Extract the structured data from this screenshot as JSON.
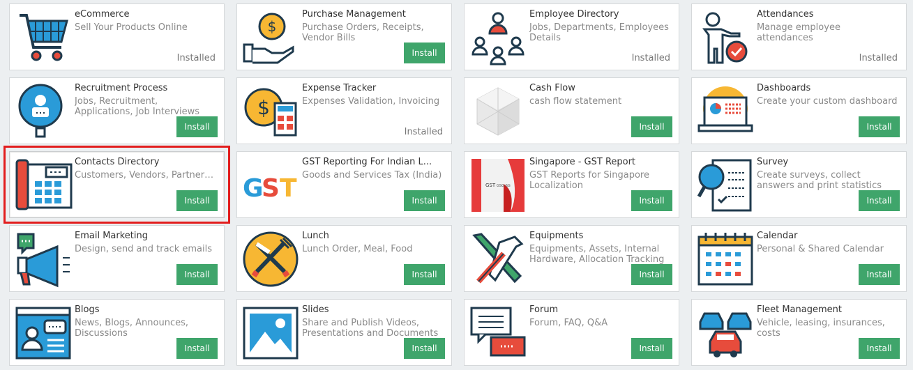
{
  "apps": [
    {
      "title": "eCommerce",
      "desc": "Sell Your Products Online",
      "status": "Installed",
      "icon": "shopping-cart-icon"
    },
    {
      "title": "Purchase Management",
      "desc": "Purchase Orders, Receipts, Vendor Bills",
      "status": "Install",
      "icon": "money-hand-icon"
    },
    {
      "title": "Employee Directory",
      "desc": "Jobs, Departments, Employees Details",
      "status": "Installed",
      "icon": "people-network-icon"
    },
    {
      "title": "Attendances",
      "desc": "Manage employee attendances",
      "status": "Installed",
      "icon": "attendance-icon"
    },
    {
      "title": "Recruitment Process",
      "desc": "Jobs, Recruitment, Applications, Job Interviews",
      "status": "Install",
      "icon": "recruitment-icon"
    },
    {
      "title": "Expense Tracker",
      "desc": "Expenses Validation, Invoicing",
      "status": "Installed",
      "icon": "expense-calculator-icon"
    },
    {
      "title": "Cash Flow",
      "desc": "cash flow statement",
      "status": "Install",
      "icon": "cube-icon"
    },
    {
      "title": "Dashboards",
      "desc": "Create your custom dashboard",
      "status": "Install",
      "icon": "dashboard-laptop-icon"
    },
    {
      "title": "Contacts Directory",
      "desc": "Customers, Vendors, Partners,...",
      "status": "Install",
      "icon": "phone-directory-icon"
    },
    {
      "title": "GST Reporting For Indian L...",
      "desc": "Goods and Services Tax (India)",
      "status": "Install",
      "icon": "gst-logo-icon"
    },
    {
      "title": "Singapore - GST Report",
      "desc": "GST Reports for Singapore Localization",
      "status": "Install",
      "icon": "singapore-flag-icon"
    },
    {
      "title": "Survey",
      "desc": "Create surveys, collect answers and print statistics",
      "status": "Install",
      "icon": "survey-magnifier-icon"
    },
    {
      "title": "Email Marketing",
      "desc": "Design, send and track emails",
      "status": "Install",
      "icon": "megaphone-icon"
    },
    {
      "title": "Lunch",
      "desc": "Lunch Order, Meal, Food",
      "status": "Install",
      "icon": "fork-knife-icon"
    },
    {
      "title": "Equipments",
      "desc": "Equipments, Assets, Internal Hardware, Allocation Tracking",
      "status": "Install",
      "icon": "tools-icon"
    },
    {
      "title": "Calendar",
      "desc": "Personal & Shared Calendar",
      "status": "Install",
      "icon": "calendar-icon"
    },
    {
      "title": "Blogs",
      "desc": "News, Blogs, Announces, Discussions",
      "status": "Install",
      "icon": "blog-icon"
    },
    {
      "title": "Slides",
      "desc": "Share and Publish Videos, Presentations and Documents",
      "status": "Install",
      "icon": "slides-icon"
    },
    {
      "title": "Forum",
      "desc": "Forum, FAQ, Q&A",
      "status": "Install",
      "icon": "forum-chat-icon"
    },
    {
      "title": "Fleet Management",
      "desc": "Vehicle, leasing, insurances, costs",
      "status": "Install",
      "icon": "cars-icon"
    }
  ],
  "selected_index": 8,
  "colors": {
    "install_button": "#3fa56b",
    "selection_outline": "#e21d1d"
  }
}
